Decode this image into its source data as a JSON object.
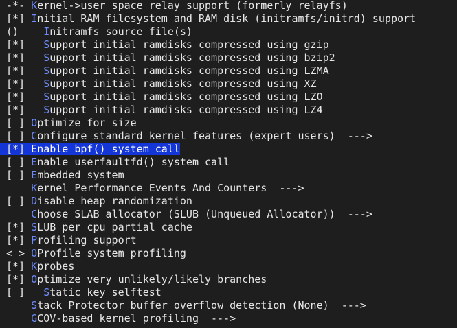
{
  "menu": {
    "items": [
      {
        "mark": " -*- ",
        "indent": "",
        "hot": "K",
        "rest": "ernel->user space relay support (formerly relayfs)",
        "selected": false
      },
      {
        "mark": " [*] ",
        "indent": "",
        "hot": "I",
        "rest": "nitial RAM filesystem and RAM disk (initramfs/initrd) support",
        "selected": false
      },
      {
        "mark": " ()  ",
        "indent": "  ",
        "hot": "I",
        "rest": "nitramfs source file(s)",
        "selected": false
      },
      {
        "mark": " [*] ",
        "indent": "  ",
        "hot": "S",
        "rest": "upport initial ramdisks compressed using gzip",
        "selected": false
      },
      {
        "mark": " [*] ",
        "indent": "  ",
        "hot": "S",
        "rest": "upport initial ramdisks compressed using bzip2",
        "selected": false
      },
      {
        "mark": " [*] ",
        "indent": "  ",
        "hot": "S",
        "rest": "upport initial ramdisks compressed using LZMA",
        "selected": false
      },
      {
        "mark": " [*] ",
        "indent": "  ",
        "hot": "S",
        "rest": "upport initial ramdisks compressed using XZ",
        "selected": false
      },
      {
        "mark": " [*] ",
        "indent": "  ",
        "hot": "S",
        "rest": "upport initial ramdisks compressed using LZO",
        "selected": false
      },
      {
        "mark": " [*] ",
        "indent": "  ",
        "hot": "S",
        "rest": "upport initial ramdisks compressed using LZ4",
        "selected": false
      },
      {
        "mark": " [ ] ",
        "indent": "",
        "hot": "O",
        "rest": "ptimize for size",
        "selected": false
      },
      {
        "mark": " [ ] ",
        "indent": "",
        "hot": "C",
        "rest": "onfigure standard kernel features (expert users)  --->",
        "selected": false
      },
      {
        "mark": " [*] ",
        "indent": "",
        "hot": "E",
        "rest": "nable bpf() system call",
        "selected": true
      },
      {
        "mark": " [ ] ",
        "indent": "",
        "hot": "E",
        "rest": "nable userfaultfd() system call",
        "selected": false
      },
      {
        "mark": " [ ] ",
        "indent": "",
        "hot": "E",
        "rest": "mbedded system",
        "selected": false
      },
      {
        "mark": "     ",
        "indent": "",
        "hot": "K",
        "rest": "ernel Performance Events And Counters  --->",
        "selected": false
      },
      {
        "mark": " [ ] ",
        "indent": "",
        "hot": "D",
        "rest": "isable heap randomization",
        "selected": false
      },
      {
        "mark": "     ",
        "indent": "",
        "hot": "C",
        "rest": "hoose SLAB allocator (SLUB (Unqueued Allocator))  --->",
        "selected": false
      },
      {
        "mark": " [*] ",
        "indent": "",
        "hot": "S",
        "rest": "LUB per cpu partial cache",
        "selected": false
      },
      {
        "mark": " [*] ",
        "indent": "",
        "hot": "P",
        "rest": "rofiling support",
        "selected": false
      },
      {
        "mark": " < > ",
        "indent": "",
        "hot": "O",
        "rest": "Profile system profiling",
        "selected": false
      },
      {
        "mark": " [*] ",
        "indent": "",
        "hot": "K",
        "rest": "probes",
        "selected": false
      },
      {
        "mark": " [*] ",
        "indent": "",
        "hot": "O",
        "rest": "ptimize very unlikely/likely branches",
        "selected": false
      },
      {
        "mark": " [ ] ",
        "indent": "  ",
        "hot": "S",
        "rest": "tatic key selftest",
        "selected": false
      },
      {
        "mark": "     ",
        "indent": "",
        "hot": "S",
        "rest": "tack Protector buffer overflow detection (None)  --->",
        "selected": false
      },
      {
        "mark": "     ",
        "indent": "",
        "hot": "G",
        "rest": "COV-based kernel profiling  --->",
        "selected": false
      }
    ]
  },
  "colors": {
    "background": "#1e1e1e",
    "text": "#e6e6e6",
    "hotkey": "#6f8cff",
    "selection": "#1436d6"
  }
}
